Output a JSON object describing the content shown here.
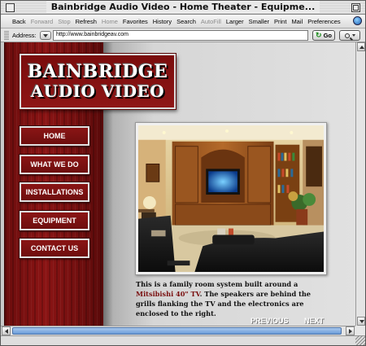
{
  "window": {
    "title": "Bainbridge Audio Video - Home Theater - Equipme..."
  },
  "toolbar": {
    "items": [
      {
        "label": "Back",
        "enabled": true
      },
      {
        "label": "Forward",
        "enabled": false
      },
      {
        "label": "Stop",
        "enabled": false
      },
      {
        "label": "Refresh",
        "enabled": true
      },
      {
        "label": "Home",
        "enabled": false
      },
      {
        "label": "Favorites",
        "enabled": true
      },
      {
        "label": "History",
        "enabled": true
      },
      {
        "label": "Search",
        "enabled": true
      },
      {
        "label": "AutoFill",
        "enabled": false
      },
      {
        "label": "Larger",
        "enabled": true
      },
      {
        "label": "Smaller",
        "enabled": true
      },
      {
        "label": "Print",
        "enabled": true
      },
      {
        "label": "Mail",
        "enabled": true
      },
      {
        "label": "Preferences",
        "enabled": true
      }
    ]
  },
  "address": {
    "label": "Address:",
    "url": "http://www.bainbridgeav.com",
    "go_label": "Go"
  },
  "logo": {
    "line1": "BAINBRIDGE",
    "line2": "AUDIO VIDEO"
  },
  "nav": {
    "items": [
      "HOME",
      "WHAT WE DO",
      "INSTALLATIONS",
      "EQUIPMENT",
      "CONTACT US"
    ]
  },
  "caption": {
    "before": "This is a family room system built around a ",
    "highlight": "Mitsibishi 40\" TV",
    "after": ". The speakers are behind the grills flanking the TV and the electronics are enclosed to the right."
  },
  "pager": {
    "previous": "PREVIOUS",
    "next": "NEXT"
  },
  "colors": {
    "brand_red": "#7a0c0c",
    "highlight_text": "#7a1010"
  }
}
